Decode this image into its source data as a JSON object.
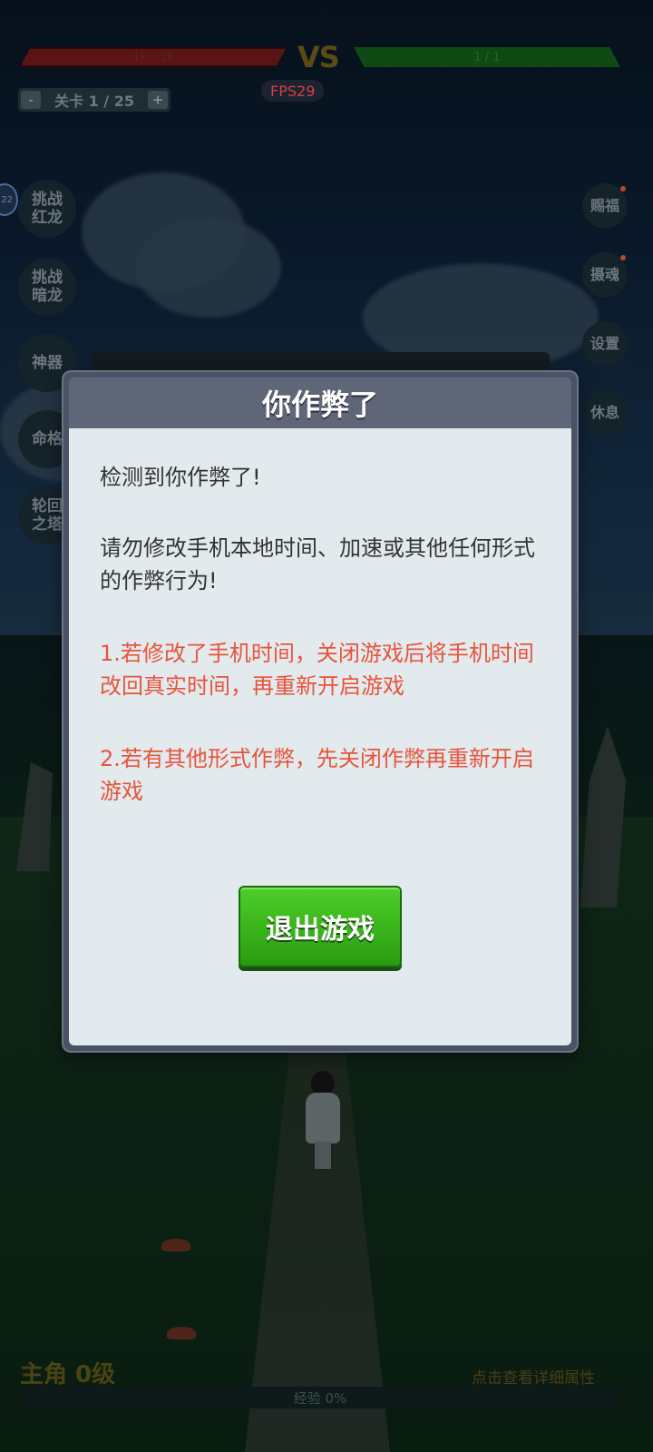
{
  "hud": {
    "player_hp": "1K / 1K",
    "vs_label": "VS",
    "enemy_hp": "1 / 1",
    "level_minus": "-",
    "level_text": "关卡 1 / 25",
    "level_plus": "+",
    "fps": "FPS29",
    "edge_badge": "22"
  },
  "left_menu": [
    {
      "label_line1": "挑战",
      "label_line2": "红龙"
    },
    {
      "label_line1": "挑战",
      "label_line2": "暗龙"
    },
    {
      "label_line1": "神器",
      "label_line2": ""
    },
    {
      "label_line1": "命格",
      "label_line2": ""
    },
    {
      "label_line1": "轮回",
      "label_line2": "之塔"
    }
  ],
  "right_menu": [
    {
      "label": "赐福"
    },
    {
      "label": "摄魂"
    },
    {
      "label": "设置"
    },
    {
      "label": "休息"
    }
  ],
  "dialog": {
    "title": "你作弊了",
    "line1": "检测到你作弊了!",
    "line2": "请勿修改手机本地时间、加速或其他任何形式的作弊行为!",
    "line3": "1.若修改了手机时间，关闭游戏后将手机时间改回真实时间，再重新开启游戏",
    "line4": "2.若有其他形式作弊，先关闭作弊再重新开启游戏",
    "exit_button": "退出游戏"
  },
  "footer": {
    "hero_level": "主角 0级",
    "detail_link": "点击查看详细属性",
    "exp": "经验 0%"
  },
  "colors": {
    "warning_red": "#e8543c",
    "exit_green": "#38b41a",
    "dialog_header": "#5f6678"
  }
}
